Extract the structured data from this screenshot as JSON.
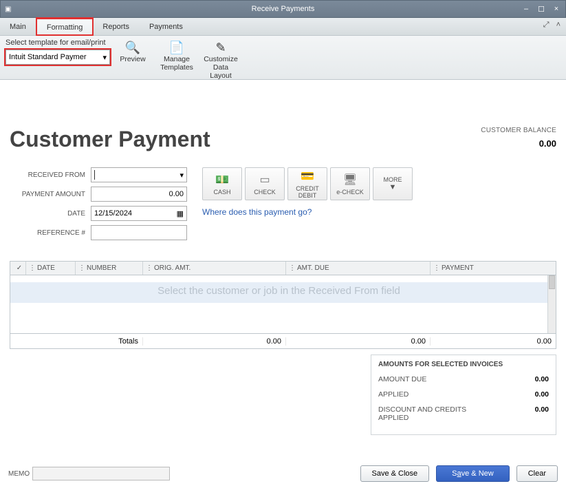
{
  "window": {
    "title": "Receive Payments"
  },
  "tabs": {
    "main": "Main",
    "formatting": "Formatting",
    "reports": "Reports",
    "payments": "Payments"
  },
  "ribbon": {
    "template_label": "Select template for email/print",
    "template_value": "Intuit Standard Paymer",
    "preview": "Preview",
    "manage_templates_l1": "Manage",
    "manage_templates_l2": "Templates",
    "customize_l1": "Customize",
    "customize_l2": "Data Layout"
  },
  "page": {
    "heading": "Customer Payment",
    "balance_label": "CUSTOMER BALANCE",
    "balance_value": "0.00"
  },
  "form": {
    "received_from_label": "RECEIVED FROM",
    "received_from_value": "",
    "payment_amount_label": "PAYMENT AMOUNT",
    "payment_amount_value": "0.00",
    "date_label": "DATE",
    "date_value": "12/15/2024",
    "reference_label": "REFERENCE #",
    "reference_value": ""
  },
  "paybtns": {
    "cash": "CASH",
    "check": "CHECK",
    "credit_l1": "CREDIT",
    "credit_l2": "DEBIT",
    "echeck": "e-CHECK",
    "more": "MORE"
  },
  "link": "Where does this payment go?",
  "grid": {
    "headers": {
      "check": "✓",
      "date": "DATE",
      "number": "NUMBER",
      "orig": "ORIG. AMT.",
      "due": "AMT. DUE",
      "pay": "PAYMENT"
    },
    "placeholder": "Select the customer or job in the Received From field",
    "totals_label": "Totals",
    "totals_orig": "0.00",
    "totals_due": "0.00",
    "totals_pay": "0.00"
  },
  "selected": {
    "title": "AMOUNTS FOR SELECTED INVOICES",
    "amount_due_label": "AMOUNT DUE",
    "amount_due_value": "0.00",
    "applied_label": "APPLIED",
    "applied_value": "0.00",
    "discount_label_l1": "DISCOUNT AND CREDITS",
    "discount_label_l2": "APPLIED",
    "discount_value": "0.00"
  },
  "footer": {
    "memo_label": "MEMO",
    "memo_value": "",
    "save_close": "Save & Close",
    "save_new_pre": "S",
    "save_new_ul": "a",
    "save_new_post": "ve & New",
    "clear": "Clear"
  }
}
